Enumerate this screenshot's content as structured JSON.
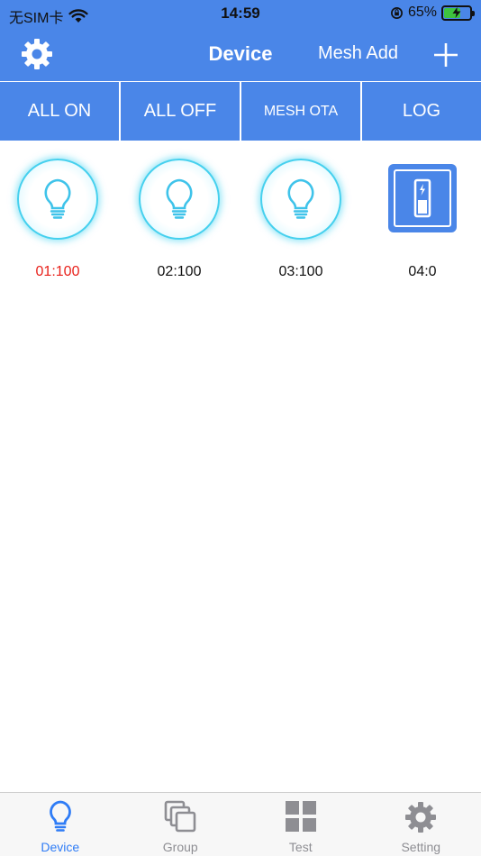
{
  "status_bar": {
    "carrier": "无SIM卡",
    "time": "14:59",
    "battery": "65%",
    "battery_level": 0.65
  },
  "nav": {
    "title": "Device",
    "mesh_add_label": "Mesh Add",
    "settings_icon": "gear-icon",
    "add_icon": "plus-icon"
  },
  "actions": [
    {
      "label": "ALL ON"
    },
    {
      "label": "ALL OFF"
    },
    {
      "label": "MESH OTA"
    },
    {
      "label": "LOG"
    }
  ],
  "devices": [
    {
      "label": "01:100",
      "type": "bulb",
      "label_color": "#e8201a"
    },
    {
      "label": "02:100",
      "type": "bulb",
      "label_color": "#111111"
    },
    {
      "label": "03:100",
      "type": "bulb",
      "label_color": "#111111"
    },
    {
      "label": "04:0",
      "type": "switch",
      "label_color": "#111111"
    }
  ],
  "tabs": [
    {
      "label": "Device",
      "icon": "bulb-icon",
      "active": true
    },
    {
      "label": "Group",
      "icon": "group-icon",
      "active": false
    },
    {
      "label": "Test",
      "icon": "grid-icon",
      "active": false
    },
    {
      "label": "Setting",
      "icon": "gear-icon",
      "active": false
    }
  ],
  "colors": {
    "primary": "#4A86E8",
    "active_tab": "#2f7cf6",
    "inactive_tab": "#8e8e93",
    "bulb_glow": "#45d0ee"
  }
}
